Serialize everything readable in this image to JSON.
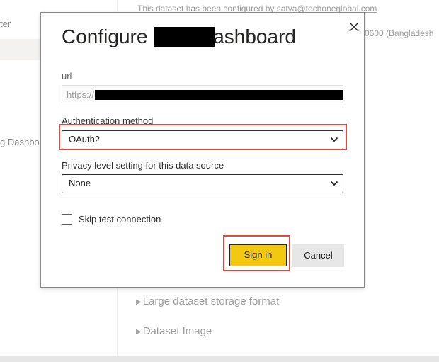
{
  "background": {
    "sidebar_items": [
      "ter",
      "g Dashbo"
    ],
    "notice_prefix": "This dataset has been configured by ",
    "notice_email": "satya@techoneglobal.com",
    "notice_suffix": ".",
    "timezone_fragment": "0600 (Bangladesh",
    "sections": [
      "Large dataset storage format",
      "Dataset Image"
    ]
  },
  "dialog": {
    "title_start": "Configure",
    "title_end": "ashboard",
    "url_label": "url",
    "url_value": "https://",
    "auth_label": "Authentication method",
    "auth_value": "OAuth2",
    "privacy_label": "Privacy level setting for this data source",
    "privacy_value": "None",
    "skip_label": "Skip test connection",
    "skip_checked": false,
    "signin_label": "Sign in",
    "cancel_label": "Cancel"
  },
  "icons": {
    "close": "close-icon",
    "chevron": "chevron-down-icon",
    "section_arrow": "caret-right-icon"
  },
  "colors": {
    "signin_bg": "#f2c811",
    "highlight": "#d14f45",
    "muted_text": "#a19f9d"
  }
}
